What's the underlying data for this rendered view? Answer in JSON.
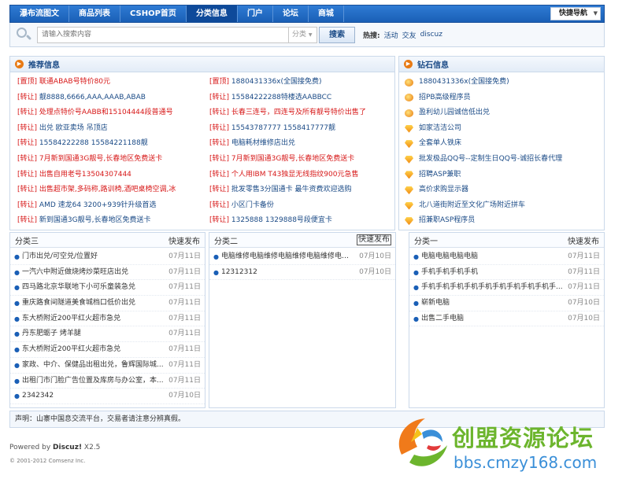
{
  "nav": {
    "items": [
      "瀑布流图文",
      "商品列表",
      "CSHOP首页",
      "分类信息",
      "门户",
      "论坛",
      "商城"
    ],
    "active_index": 3,
    "quicknav": "快捷导航"
  },
  "search": {
    "placeholder": "请输入搜索内容",
    "select": "分类",
    "button": "搜索",
    "hot_label": "热搜:",
    "hot": [
      "活动",
      "交友",
      "discuz"
    ]
  },
  "recommend": {
    "title": "推荐信息",
    "left": [
      {
        "tag": "[置顶]",
        "text": "联通ABAB号特价80元",
        "color": "red"
      },
      {
        "tag": "[转让]",
        "text": "靓8888,6666,AAA,AAAB,ABAB",
        "color": "blue"
      },
      {
        "tag": "[转让]",
        "text": "处理点特价号AABB和15104444段普通号",
        "color": "red"
      },
      {
        "tag": "[转让]",
        "text": "出兑 欧亚卖场 吊顶店",
        "color": "blue"
      },
      {
        "tag": "[转让]",
        "text": "15584222288 15584221188靓",
        "color": "blue"
      },
      {
        "tag": "[转让]",
        "text": "7月新到国通3G靓号,长春地区免费送卡",
        "color": "red"
      },
      {
        "tag": "[转让]",
        "text": "出售自用老号13504307444",
        "color": "red"
      },
      {
        "tag": "[转让]",
        "text": "出售超市架,多码称,路训椅,酒吧桌椅空调,冰",
        "color": "red"
      },
      {
        "tag": "[转让]",
        "text": "AMD 速龙64 3200+939针升级首选",
        "color": "blue"
      },
      {
        "tag": "[转让]",
        "text": "新到国通3G靓号,长春地区免费送卡",
        "color": "blue"
      }
    ],
    "right": [
      {
        "tag": "[置顶]",
        "text": "1880431336x(全国接免费)",
        "color": "blue"
      },
      {
        "tag": "[转让]",
        "text": "15584222288特楼选AABBCC",
        "color": "blue"
      },
      {
        "tag": "[转让]",
        "text": "长春三连号，四连号及所有靓号特价出售了",
        "color": "red"
      },
      {
        "tag": "[转让]",
        "text": "15543787777 1558417777靓",
        "color": "blue"
      },
      {
        "tag": "[转让]",
        "text": "电脑耗材维修店出兑",
        "color": "blue"
      },
      {
        "tag": "[转让]",
        "text": "7月新到国通3G靓号,长春地区免费送卡",
        "color": "red"
      },
      {
        "tag": "[转让]",
        "text": "个人用IBM T43独显无线指纹900元急售",
        "color": "red"
      },
      {
        "tag": "[转让]",
        "text": "批发零售3分国通卡 最牛资费欢迎选购",
        "color": "blue"
      },
      {
        "tag": "[转让]",
        "text": "小区门卡备份",
        "color": "blue"
      },
      {
        "tag": "[转让]",
        "text": "1325888 1329888号段便宜卡",
        "color": "blue"
      }
    ]
  },
  "diamond": {
    "title": "钻石信息",
    "items": [
      {
        "icon": "badge-icon",
        "text": "1880431336x(全国接免费)"
      },
      {
        "icon": "badge-icon",
        "text": "招PB高级程序员"
      },
      {
        "icon": "badge-icon",
        "text": "盈利幼儿园诚信低出兑"
      },
      {
        "icon": "gem-icon",
        "text": "如家洁洁公司"
      },
      {
        "icon": "gem-icon",
        "text": "全套单人铁床"
      },
      {
        "icon": "gem-icon",
        "text": "批发极品QQ号--定制生日QQ号-诚招长春代理"
      },
      {
        "icon": "gem-icon",
        "text": "招聘ASP兼职"
      },
      {
        "icon": "gem-icon",
        "text": "高价求购显示器"
      },
      {
        "icon": "gem-icon",
        "text": "北八道街附近至文化广场附近拼车"
      },
      {
        "icon": "gem-icon",
        "text": "招兼职ASP程序员"
      }
    ]
  },
  "cats": [
    {
      "title": "分类三",
      "post": "快速发布",
      "rows": [
        {
          "t": "门市出兑/可空兑/位置好",
          "d": "07月11日"
        },
        {
          "t": "一汽六中附近做烧烤炒菜旺店出兑",
          "d": "07月11日"
        },
        {
          "t": "四马路北京华联地下小可乐童装急兑",
          "d": "07月11日"
        },
        {
          "t": "重庆路食间隧道美食城档口低价出兑",
          "d": "07月11日"
        },
        {
          "t": "东大桥附近200平红火超市急兑",
          "d": "07月11日"
        },
        {
          "t": "丹东肥蛎子 烤羊腿",
          "d": "07月11日"
        },
        {
          "t": "东大桥附近200平红火超市急兑",
          "d": "07月11日"
        },
        {
          "t": "家政、中介、保健品出租出兑，鲁辉国际城...",
          "d": "07月11日"
        },
        {
          "t": "出租门市门脸广告位置及库房与办公室，本...",
          "d": "07月11日"
        },
        {
          "t": "2342342",
          "d": "07月10日"
        }
      ]
    },
    {
      "title": "分类二",
      "post": "快速发布",
      "rows": [
        {
          "t": "电脑维修电脑维修电脑维修电脑维修电脑维...",
          "d": "07月10日"
        },
        {
          "t": "12312312",
          "d": "07月10日"
        }
      ]
    },
    {
      "title": "分类一",
      "post": "快速发布",
      "rows": [
        {
          "t": "电脑电脑电脑电脑",
          "d": "07月11日"
        },
        {
          "t": "手机手机手机手机",
          "d": "07月11日"
        },
        {
          "t": "手机手机手机手机手机手机手机手机手机手...",
          "d": "07月11日"
        },
        {
          "t": "崭新电脑",
          "d": "07月10日"
        },
        {
          "t": "出售二手电脑",
          "d": "07月10日"
        }
      ]
    }
  ],
  "notice": "声明：山寨中国息交流平台，交易者请注意分辨真假。",
  "footer": {
    "powered": "Powered by",
    "brand": "Discuz!",
    "version": "X2.5",
    "copyright": "© 2001-2012 Comsenz Inc."
  },
  "watermark": {
    "title": "创盟资源论坛",
    "url": "bbs.cmzy168.com"
  },
  "colors": {
    "nav": "#1a5fb6",
    "red": "#d71818",
    "link": "#1a4a86",
    "logo_green": "#6cb52d"
  }
}
